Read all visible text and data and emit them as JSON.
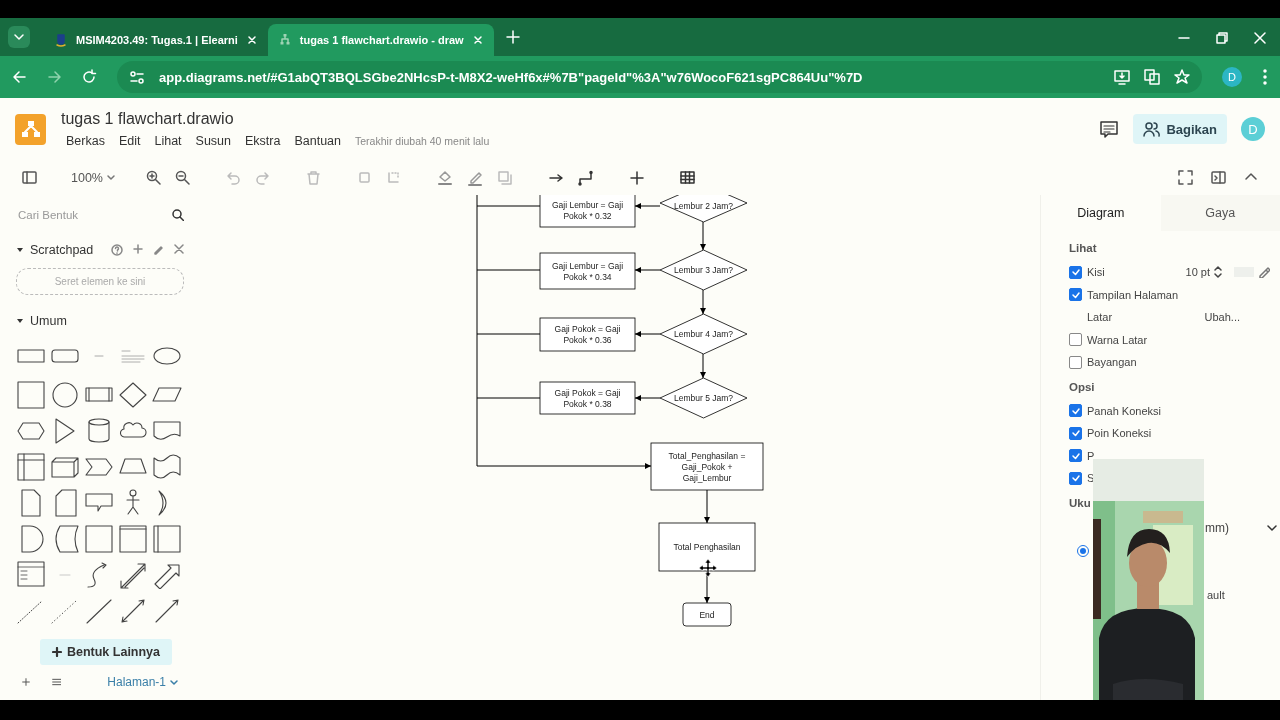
{
  "browser": {
    "tabs": [
      {
        "title": "MSIM4203.49: Tugas.1 | Elearni",
        "selected": false
      },
      {
        "title": "tugas 1 flawchart.drawio - draw",
        "selected": true
      }
    ],
    "url": "app.diagrams.net/#G1abQT3BQLSGbe2NHcsP-t-M8X2-weHf6x#%7B\"pageId\"%3A\"w76WocoF621sgPC864Uu\"%7D",
    "profile": "D"
  },
  "app": {
    "title": "tugas 1 flawchart.drawio",
    "menu": [
      "Berkas",
      "Edit",
      "Lihat",
      "Susun",
      "Ekstra",
      "Bantuan"
    ],
    "last_saved": "Terakhir diubah 40 menit lalu",
    "share": "Bagikan",
    "avatar": "D"
  },
  "toolbar": {
    "zoom": "100%"
  },
  "sidebar": {
    "search": {
      "placeholder": "Cari Bentuk"
    },
    "scratchpad": {
      "title": "Scratchpad",
      "expanded": true,
      "drop_hint": "Seret elemen ke sini"
    },
    "general": {
      "title": "Umum",
      "expanded": true
    },
    "more_shapes": "Bentuk Lainnya",
    "page_tab": "Halaman-1"
  },
  "diagram": {
    "nodes": [
      {
        "kind": "process",
        "lines": [
          "Gaji Lembur = Gaji",
          "Pokok * 0.32"
        ]
      },
      {
        "kind": "decision",
        "lines": [
          "Lembur 2 Jam?"
        ]
      },
      {
        "kind": "process",
        "lines": [
          "Gaji Lembur = Gaji",
          "Pokok * 0.34"
        ]
      },
      {
        "kind": "decision",
        "lines": [
          "Lembur 3 Jam?"
        ]
      },
      {
        "kind": "process",
        "lines": [
          "Gaji Pokok = Gaji",
          "Pokok * 0.36"
        ]
      },
      {
        "kind": "decision",
        "lines": [
          "Lembur 4 Jam?"
        ]
      },
      {
        "kind": "process",
        "lines": [
          "Gaji Pokok = Gaji",
          "Pokok * 0.38"
        ]
      },
      {
        "kind": "decision",
        "lines": [
          "Lembur 5 Jam?"
        ]
      },
      {
        "kind": "process",
        "lines": [
          "Total_Penghasilan =",
          "Gaji_Pokok +",
          "Gaji_Lembur"
        ]
      },
      {
        "kind": "process",
        "lines": [
          "Total Penghasilan"
        ]
      },
      {
        "kind": "terminal",
        "lines": [
          "End"
        ]
      }
    ]
  },
  "format_panel": {
    "tabs": [
      {
        "label": "Diagram",
        "selected": true
      },
      {
        "label": "Gaya",
        "selected": false
      }
    ],
    "sections": [
      {
        "title": "Lihat",
        "rows": [
          {
            "kind": "checkbox",
            "label": "Kisi",
            "checked": true,
            "value": "10 pt"
          },
          {
            "kind": "checkbox",
            "label": "Tampilan Halaman",
            "checked": true
          },
          {
            "kind": "setting",
            "label": "Latar",
            "value": "Ubah..."
          },
          {
            "kind": "checkbox",
            "label": "Warna Latar",
            "checked": false
          },
          {
            "kind": "checkbox",
            "label": "Bayangan",
            "checked": false
          }
        ]
      },
      {
        "title": "Opsi",
        "rows": [
          {
            "kind": "checkbox",
            "label": "Panah Koneksi",
            "checked": true
          },
          {
            "kind": "checkbox",
            "label": "Poin Koneksi",
            "checked": true
          },
          {
            "kind": "checkbox",
            "label": "P",
            "checked": true
          },
          {
            "kind": "checkbox",
            "label": "S",
            "checked": true
          }
        ]
      },
      {
        "title": "Uku",
        "rows": [
          {
            "kind": "select",
            "value": "mm)"
          },
          {
            "kind": "radio",
            "selected": true
          },
          {
            "kind": "text",
            "text": "ault"
          }
        ]
      }
    ]
  }
}
